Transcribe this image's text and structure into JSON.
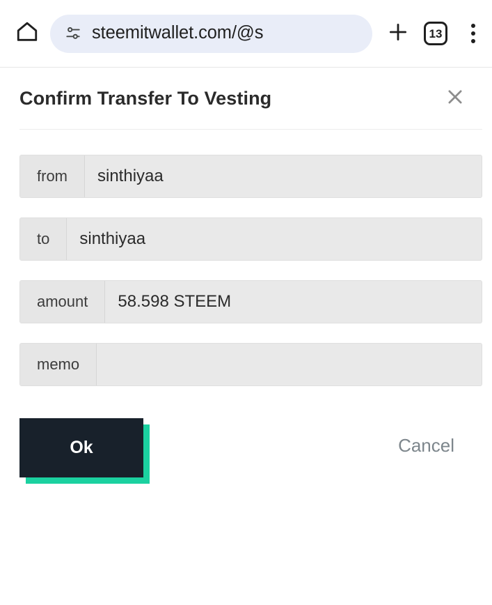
{
  "browser": {
    "home_icon": "home-icon",
    "site_settings_icon": "tune-icon",
    "url": "steemitwallet.com/@s",
    "new_tab_icon": "plus-icon",
    "tab_count": "13",
    "menu_icon": "more-vertical-icon"
  },
  "dialog": {
    "title": "Confirm Transfer To Vesting",
    "close_icon": "close-icon",
    "fields": [
      {
        "label": "from",
        "value": "sinthiyaa"
      },
      {
        "label": "to",
        "value": "sinthiyaa"
      },
      {
        "label": "amount",
        "value": "58.598 STEEM"
      },
      {
        "label": "memo",
        "value": ""
      }
    ],
    "ok_label": "Ok",
    "cancel_label": "Cancel"
  },
  "colors": {
    "ok_background": "#18212b",
    "ok_shadow": "#1bd1a0",
    "omnibox_background": "#e9edf8",
    "cancel_text": "#7d868c",
    "field_background": "#e9e9e9"
  }
}
